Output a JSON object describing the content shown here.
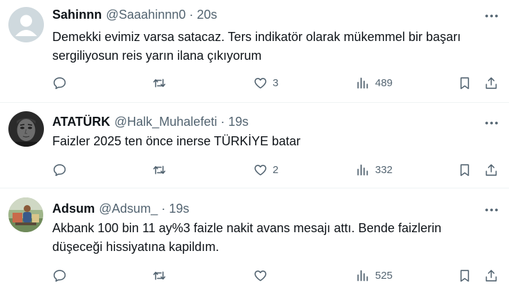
{
  "tweets": [
    {
      "name": "Sahinnn",
      "handle": "@Saaahinnn0",
      "dot": "·",
      "time": "20s",
      "avatar_icon": "default-profile-icon",
      "lines": [
        "Demekki evimiz varsa satacaz. Ters indikatör olarak mükemmel bir başarı",
        "sergiliyosun reis yarın ilana çıkıyorum"
      ],
      "likes": "3",
      "views": "489"
    },
    {
      "name": "ATATÜRK",
      "handle": "@Halk_Muhalefeti",
      "dot": "·",
      "time": "19s",
      "avatar_icon": "portrait-photo",
      "lines": [
        "Faizler 2025 ten önce inerse TÜRKİYE batar"
      ],
      "likes": "2",
      "views": "332"
    },
    {
      "name": "Adsum",
      "handle": "@Adsum_",
      "dot": "·",
      "time": "19s",
      "avatar_icon": "outdoor-photo",
      "lines": [
        "Akbank 100 bin 11 ay%3 faizle nakit avans mesajı attı. Bende faizlerin",
        "düşeceği hissiyatına kapildım."
      ],
      "likes": "",
      "views": "525"
    }
  ],
  "colors": {
    "text": "#0f1419",
    "secondary": "#536471",
    "divider": "#eff3f4"
  },
  "icons": [
    "reply-icon",
    "retweet-icon",
    "like-icon",
    "views-icon",
    "bookmark-icon",
    "share-icon",
    "more-icon"
  ]
}
